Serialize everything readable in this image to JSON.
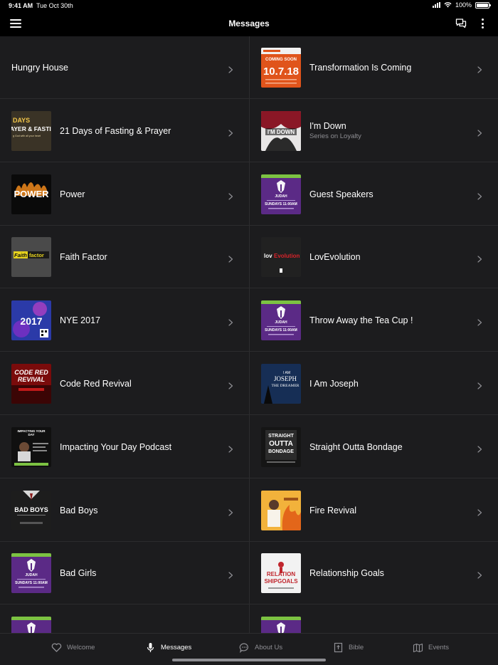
{
  "status_bar": {
    "time": "9:41 AM",
    "date": "Tue Oct 30th",
    "battery": "100%"
  },
  "nav": {
    "title": "Messages"
  },
  "messages": {
    "left": [
      {
        "title": "Hungry House",
        "subtitle": "",
        "thumb": "none"
      },
      {
        "title": "21 Days of Fasting & Prayer",
        "subtitle": "",
        "thumb": "fasting"
      },
      {
        "title": "Power",
        "subtitle": "",
        "thumb": "power"
      },
      {
        "title": "Faith Factor",
        "subtitle": "",
        "thumb": "faith"
      },
      {
        "title": "NYE 2017",
        "subtitle": "",
        "thumb": "nye"
      },
      {
        "title": "Code Red Revival",
        "subtitle": "",
        "thumb": "codered"
      },
      {
        "title": "Impacting Your Day Podcast",
        "subtitle": "",
        "thumb": "podcast"
      },
      {
        "title": "Bad Boys",
        "subtitle": "",
        "thumb": "badboys"
      },
      {
        "title": "Bad Girls",
        "subtitle": "",
        "thumb": "judah"
      },
      {
        "title": "",
        "subtitle": "",
        "thumb": "judah"
      }
    ],
    "right": [
      {
        "title": "Transformation Is Coming",
        "subtitle": "",
        "thumb": "transform"
      },
      {
        "title": "I'm Down",
        "subtitle": "Series on Loyalty",
        "thumb": "imdown"
      },
      {
        "title": "Guest Speakers",
        "subtitle": "",
        "thumb": "judah"
      },
      {
        "title": "LovEvolution",
        "subtitle": "",
        "thumb": "lovevo"
      },
      {
        "title": "Throw Away the Tea Cup !",
        "subtitle": "",
        "thumb": "judah"
      },
      {
        "title": "I Am Joseph",
        "subtitle": "",
        "thumb": "joseph"
      },
      {
        "title": "Straight Outta Bondage",
        "subtitle": "",
        "thumb": "outta"
      },
      {
        "title": "Fire Revival",
        "subtitle": "",
        "thumb": "fire"
      },
      {
        "title": "Relationship Goals",
        "subtitle": "",
        "thumb": "relgoals"
      },
      {
        "title": "",
        "subtitle": "",
        "thumb": "judah"
      }
    ]
  },
  "thumb_text": {
    "fasting": [
      "DAYS",
      "AYER & FASTI",
      "g God with all your heart"
    ],
    "power": [
      "POWER"
    ],
    "faith": [
      "Faith",
      "factor"
    ],
    "nye": [
      "2017"
    ],
    "codered": [
      "CODE RED",
      "REVIVAL"
    ],
    "podcast": [
      "IMPACTING YOUR",
      "DAY"
    ],
    "badboys": [
      "BAD BOYS"
    ],
    "judah": [
      "JUDAH",
      "SUNDAYS 11:00AM"
    ],
    "transform": [
      "COMING SOON",
      "10.7.18"
    ],
    "imdown": [
      "I'M DOWN"
    ],
    "lovevo": [
      "lov",
      "Evolution"
    ],
    "joseph": [
      "I AM",
      "JOSEPH",
      "THE DREAMER"
    ],
    "outta": [
      "STRAIGHT",
      "OUTTA",
      "BONDAGE"
    ],
    "relgoals": [
      "RELATION",
      "SHIP",
      "GOALS"
    ]
  },
  "tabs": [
    {
      "label": "Welcome",
      "icon": "heart-icon",
      "active": false
    },
    {
      "label": "Messages",
      "icon": "microphone-icon",
      "active": true
    },
    {
      "label": "About Us",
      "icon": "speech-bubble-icon",
      "active": false
    },
    {
      "label": "Bible",
      "icon": "bible-icon",
      "active": false
    },
    {
      "label": "Events",
      "icon": "map-icon",
      "active": false
    }
  ],
  "colors": {
    "background": "#000000",
    "list_bg": "#1c1c1e",
    "divider": "#2c2c2e",
    "secondary_text": "#8e8e93",
    "judah_purple": "#5b2a86",
    "judah_green": "#7cc242"
  }
}
